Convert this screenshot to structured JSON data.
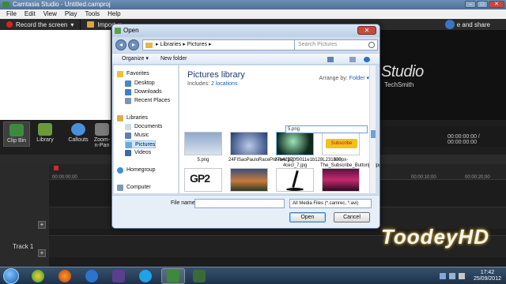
{
  "app": {
    "title": "Camtasia Studio - Untitled.camproj",
    "menu": [
      "File",
      "Edit",
      "View",
      "Play",
      "Tools",
      "Help"
    ],
    "toolbar": {
      "record_label": "Record the screen",
      "import_label": "Import m",
      "produce_label": "e and share"
    },
    "brand": {
      "studio": "Studio",
      "techsmith": "TechSmith"
    },
    "tools": [
      {
        "label": "Clip Bin",
        "color": "#3d8a3d"
      },
      {
        "label": "Library",
        "color": "#6b9a3a"
      },
      {
        "label": "Callouts",
        "color": "#4a90d9"
      },
      {
        "label": "Zoom-n-Pan",
        "color": "#7a7a7a"
      }
    ],
    "time_display": "00:00:00:00 / 00:00:00:00",
    "ruler_labels": [
      "00:00:00;00",
      "00:00:10;00",
      "00:00:20;00"
    ],
    "track_label": "Track 1",
    "watermark": "ToodeyHD"
  },
  "dialog": {
    "title": "Open",
    "close_label": "✕",
    "breadcrumb": "▸ Libraries ▸ Pictures ▸",
    "search_placeholder": "Search Pictures",
    "organize_label": "Organize ▾",
    "new_folder_label": "New folder",
    "nav": {
      "favorites": "Favorites",
      "desktop": "Desktop",
      "downloads": "Downloads",
      "recent": "Recent Places",
      "libraries": "Libraries",
      "documents": "Documents",
      "music": "Music",
      "pictures": "Pictures",
      "videos": "Videos",
      "homegroup": "Homegroup",
      "computer": "Computer"
    },
    "library_title": "Pictures library",
    "includes_label": "Includes:",
    "locations": "2 locations",
    "arrange_label": "Arrange by:",
    "arrange_value": "Folder ▾",
    "files": [
      {
        "name": "5.png"
      },
      {
        "name": "24FISaoPauloRacePreview.jpg"
      },
      {
        "name": "27b42370f9011e1b128L231380 4cecl_7.jpg"
      },
      {
        "name": "639px-The_Subscribe_Button[1].jpg"
      },
      {
        "name": ""
      },
      {
        "name": ""
      },
      {
        "name": ""
      },
      {
        "name": ""
      }
    ],
    "rename_value": "5.png",
    "subscribe_text": "Subscribe",
    "gp2_text": "GP2",
    "filename_label": "File name:",
    "filename_value": "",
    "filter_value": "All Media Files (*.camrec, *.avi)",
    "open_label": "Open",
    "cancel_label": "Cancel"
  },
  "taskbar": {
    "time": "17:42",
    "date": "25/09/2012"
  }
}
